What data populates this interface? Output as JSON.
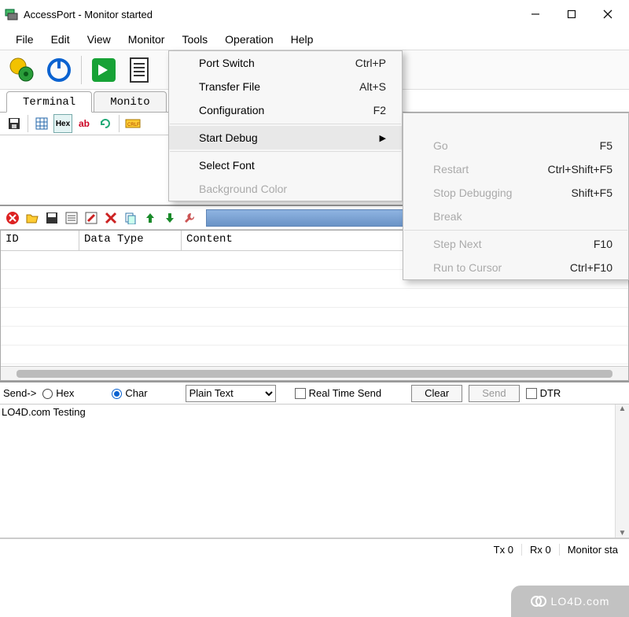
{
  "titlebar": {
    "title": "AccessPort - Monitor  started"
  },
  "menubar": [
    "File",
    "Edit",
    "View",
    "Monitor",
    "Tools",
    "Operation",
    "Help"
  ],
  "tabs": {
    "terminal": "Terminal",
    "monitor": "Monito"
  },
  "mini_toolbar": {
    "hex": "Hex",
    "ab": "ab"
  },
  "lower_toolbar": {
    "clear": "Clear"
  },
  "table": {
    "cols": {
      "id": "ID",
      "datatype": "Data Type",
      "content": "Content"
    }
  },
  "send_row": {
    "label": "Send->",
    "hex": "Hex",
    "char": "Char",
    "format_selected": "Plain Text",
    "realtime": "Real Time Send",
    "clear": "Clear",
    "send": "Send",
    "dtr": "DTR"
  },
  "input_text": "LO4D.com Testing",
  "statusbar": {
    "tx": "Tx 0",
    "rx": "Rx 0",
    "monitor": "Monitor  sta"
  },
  "tools_menu": [
    {
      "label": "Port Switch",
      "sc": "Ctrl+P"
    },
    {
      "label": "Transfer File",
      "sc": "Alt+S"
    },
    {
      "label": "Configuration",
      "sc": "F2"
    },
    "sep",
    {
      "label": "Start Debug",
      "arrow": true,
      "hover": true
    },
    "sep",
    {
      "label": "Select Font"
    },
    {
      "label": "Background Color",
      "disabled": true
    }
  ],
  "debug_menu": [
    {
      "label": "Go",
      "sc": "F5",
      "disabled": true
    },
    {
      "label": "Restart",
      "sc": "Ctrl+Shift+F5",
      "disabled": true
    },
    {
      "label": "Stop Debugging",
      "sc": "Shift+F5",
      "disabled": true
    },
    {
      "label": "Break",
      "disabled": true
    },
    "sep",
    {
      "label": "Step Next",
      "sc": "F10",
      "disabled": true
    },
    {
      "label": "Run to Cursor",
      "sc": "Ctrl+F10",
      "disabled": true
    }
  ],
  "watermark": "LO4D.com"
}
